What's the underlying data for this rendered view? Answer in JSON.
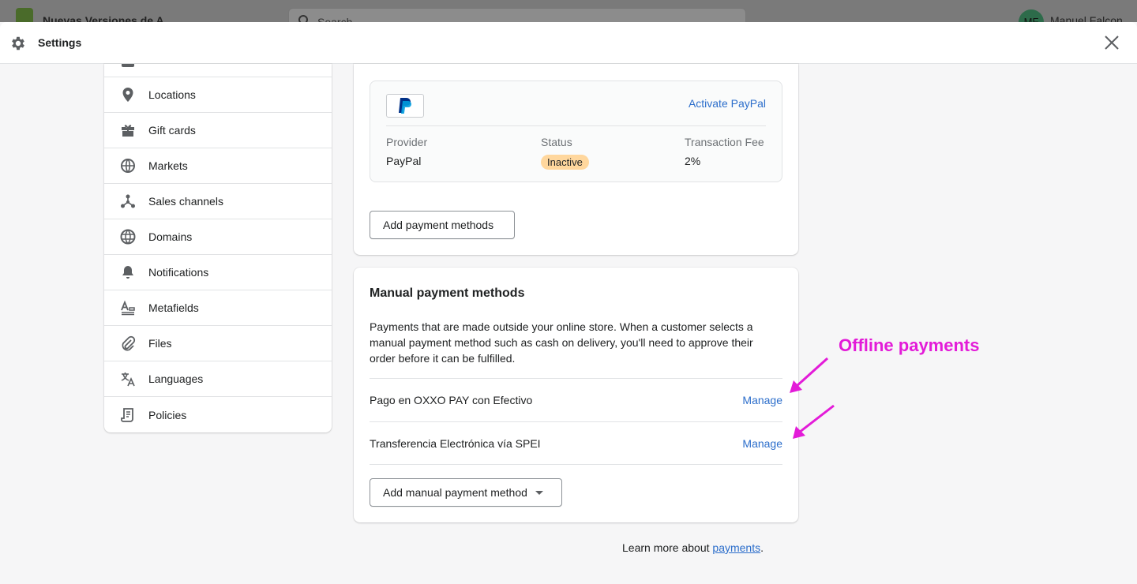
{
  "topbar": {
    "store_name": "Nuevas Versiones de A",
    "search_placeholder": "Search",
    "avatar_initials": "MF",
    "user_name": "Manuel Falcon"
  },
  "modal": {
    "title": "Settings"
  },
  "sidebar": {
    "items": [
      {
        "label": "Locations",
        "icon": "location-pin-icon"
      },
      {
        "label": "Gift cards",
        "icon": "gift-icon"
      },
      {
        "label": "Markets",
        "icon": "globe-icon"
      },
      {
        "label": "Sales channels",
        "icon": "channels-icon"
      },
      {
        "label": "Domains",
        "icon": "domain-globe-icon"
      },
      {
        "label": "Notifications",
        "icon": "bell-icon"
      },
      {
        "label": "Metafields",
        "icon": "metafields-icon"
      },
      {
        "label": "Files",
        "icon": "paperclip-icon"
      },
      {
        "label": "Languages",
        "icon": "translate-icon"
      },
      {
        "label": "Policies",
        "icon": "policy-icon"
      }
    ]
  },
  "paypal": {
    "activate_label": "Activate PayPal",
    "provider_header": "Provider",
    "status_header": "Status",
    "fee_header": "Transaction Fee",
    "provider_value": "PayPal",
    "status_value": "Inactive",
    "fee_value": "2%",
    "status_color": "#ffd79d"
  },
  "add_payment_methods_label": "Add payment methods",
  "manual": {
    "title": "Manual payment methods",
    "description": "Payments that are made outside your online store. When a customer selects a manual payment method such as cash on delivery, you'll need to approve their order before it can be fulfilled.",
    "methods": [
      {
        "name": "Pago en OXXO PAY con Efectivo",
        "action": "Manage"
      },
      {
        "name": "Transferencia Electrónica vía SPEI",
        "action": "Manage"
      }
    ],
    "add_label": "Add manual payment method"
  },
  "footer": {
    "learn_prefix": "Learn more about ",
    "learn_link": "payments",
    "learn_suffix": "."
  },
  "annotation": {
    "text": "Offline payments",
    "color": "#e31bd8"
  },
  "colors": {
    "link": "#2c6ecb",
    "border": "#e1e3e5"
  }
}
